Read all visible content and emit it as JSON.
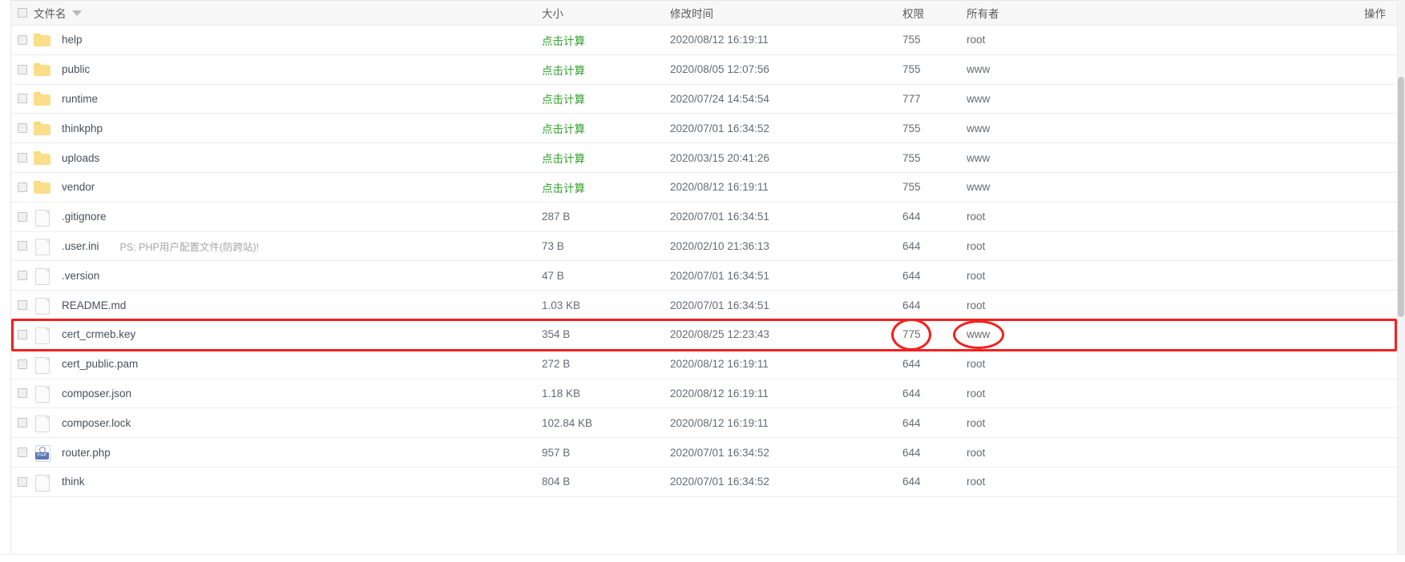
{
  "table": {
    "columns": [
      {
        "key": "name",
        "label": "文件名",
        "sortable": true,
        "sort_icon": "caret-down-icon"
      },
      {
        "key": "size",
        "label": "大小",
        "sortable": false
      },
      {
        "key": "mtime",
        "label": "修改时间",
        "sortable": false
      },
      {
        "key": "perm",
        "label": "权限",
        "sortable": false
      },
      {
        "key": "owner",
        "label": "所有者",
        "sortable": false
      },
      {
        "key": "op",
        "label": "操作",
        "sortable": false
      }
    ],
    "rows": [
      {
        "icon": "folder-icon",
        "name": "help",
        "note": "",
        "size": "点击计算",
        "size_is_link": true,
        "mtime": "2020/08/12 16:19:11",
        "perm": "755",
        "owner": "root"
      },
      {
        "icon": "folder-icon",
        "name": "public",
        "note": "",
        "size": "点击计算",
        "size_is_link": true,
        "mtime": "2020/08/05 12:07:56",
        "perm": "755",
        "owner": "www"
      },
      {
        "icon": "folder-icon",
        "name": "runtime",
        "note": "",
        "size": "点击计算",
        "size_is_link": true,
        "mtime": "2020/07/24 14:54:54",
        "perm": "777",
        "owner": "www"
      },
      {
        "icon": "folder-icon",
        "name": "thinkphp",
        "note": "",
        "size": "点击计算",
        "size_is_link": true,
        "mtime": "2020/07/01 16:34:52",
        "perm": "755",
        "owner": "www"
      },
      {
        "icon": "folder-icon",
        "name": "uploads",
        "note": "",
        "size": "点击计算",
        "size_is_link": true,
        "mtime": "2020/03/15 20:41:26",
        "perm": "755",
        "owner": "www"
      },
      {
        "icon": "folder-icon",
        "name": "vendor",
        "note": "",
        "size": "点击计算",
        "size_is_link": true,
        "mtime": "2020/08/12 16:19:11",
        "perm": "755",
        "owner": "www"
      },
      {
        "icon": "file-icon",
        "name": ".gitignore",
        "note": "",
        "size": "287 B",
        "size_is_link": false,
        "mtime": "2020/07/01 16:34:51",
        "perm": "644",
        "owner": "root"
      },
      {
        "icon": "file-icon",
        "name": ".user.ini",
        "note": "PS: PHP用户配置文件(防跨站)!",
        "size": "73 B",
        "size_is_link": false,
        "mtime": "2020/02/10 21:36:13",
        "perm": "644",
        "owner": "root"
      },
      {
        "icon": "file-icon",
        "name": ".version",
        "note": "",
        "size": "47 B",
        "size_is_link": false,
        "mtime": "2020/07/01 16:34:51",
        "perm": "644",
        "owner": "root"
      },
      {
        "icon": "file-icon",
        "name": "README.md",
        "note": "",
        "size": "1.03 KB",
        "size_is_link": false,
        "mtime": "2020/07/01 16:34:51",
        "perm": "644",
        "owner": "root"
      },
      {
        "icon": "file-icon",
        "name": "cert_crmeb.key",
        "note": "",
        "size": "354 B",
        "size_is_link": false,
        "mtime": "2020/08/25 12:23:43",
        "perm": "775",
        "owner": "www",
        "highlighted": true
      },
      {
        "icon": "file-icon",
        "name": "cert_public.pam",
        "note": "",
        "size": "272 B",
        "size_is_link": false,
        "mtime": "2020/08/12 16:19:11",
        "perm": "644",
        "owner": "root"
      },
      {
        "icon": "file-icon",
        "name": "composer.json",
        "note": "",
        "size": "1.18 KB",
        "size_is_link": false,
        "mtime": "2020/08/12 16:19:11",
        "perm": "644",
        "owner": "root"
      },
      {
        "icon": "file-icon",
        "name": "composer.lock",
        "note": "",
        "size": "102.84 KB",
        "size_is_link": false,
        "mtime": "2020/08/12 16:19:11",
        "perm": "644",
        "owner": "root"
      },
      {
        "icon": "php-icon",
        "name": "router.php",
        "note": "",
        "size": "957 B",
        "size_is_link": false,
        "mtime": "2020/07/01 16:34:52",
        "perm": "644",
        "owner": "root",
        "php_badge": "PHP"
      },
      {
        "icon": "file-icon",
        "name": "think",
        "note": "",
        "size": "804 B",
        "size_is_link": false,
        "mtime": "2020/07/01 16:34:52",
        "perm": "644",
        "owner": "root"
      }
    ]
  },
  "annotations": {
    "highlight_color": "#f42020",
    "row_rect": {
      "label": "cert_crmeb.key row outline"
    },
    "circle_perm": {
      "label": "775"
    },
    "circle_owner": {
      "label": "www"
    }
  },
  "colors": {
    "link_green": "#33a02c",
    "annotation_red": "#f42020",
    "folder_yellow": "#fade8a",
    "header_bg": "#f7f7f7"
  }
}
